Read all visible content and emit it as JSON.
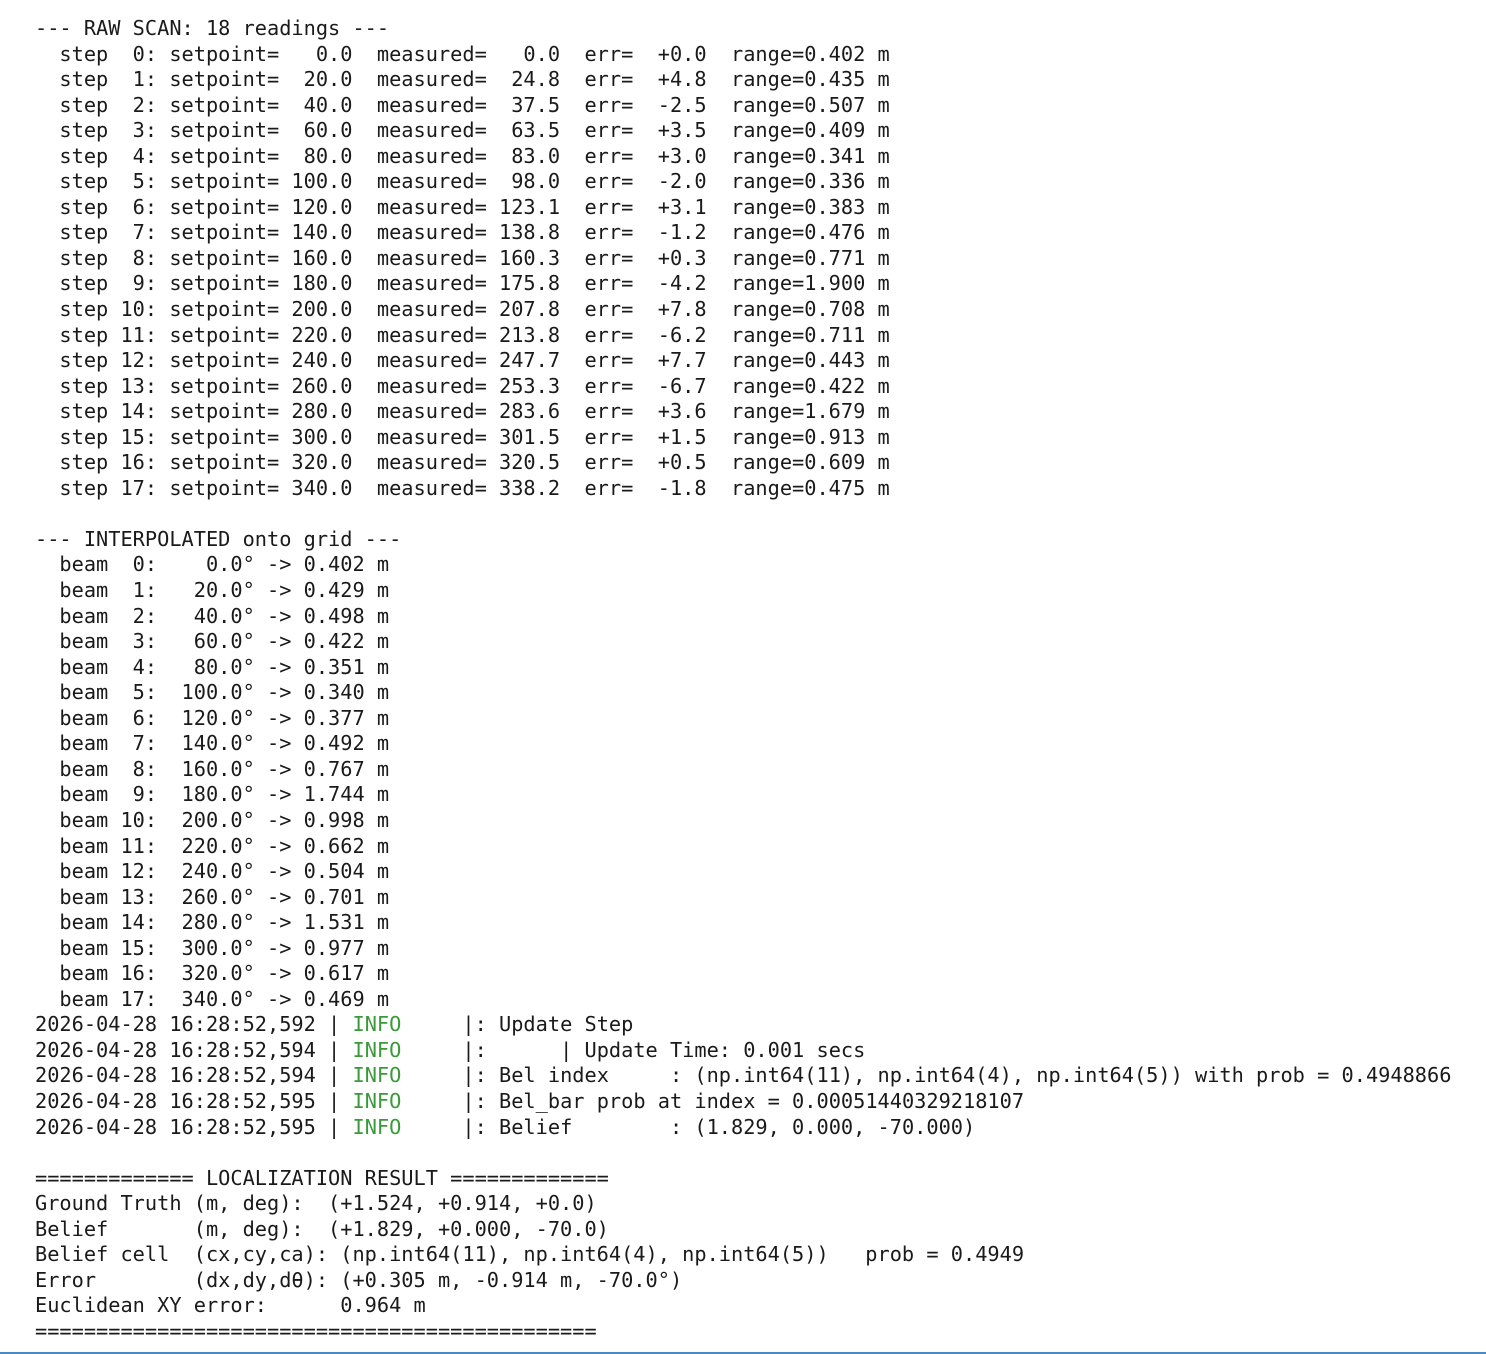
{
  "raw_scan": {
    "header": "--- RAW SCAN: 18 readings ---",
    "rows": [
      "  step  0: setpoint=   0.0  measured=   0.0  err=  +0.0  range=0.402 m",
      "  step  1: setpoint=  20.0  measured=  24.8  err=  +4.8  range=0.435 m",
      "  step  2: setpoint=  40.0  measured=  37.5  err=  -2.5  range=0.507 m",
      "  step  3: setpoint=  60.0  measured=  63.5  err=  +3.5  range=0.409 m",
      "  step  4: setpoint=  80.0  measured=  83.0  err=  +3.0  range=0.341 m",
      "  step  5: setpoint= 100.0  measured=  98.0  err=  -2.0  range=0.336 m",
      "  step  6: setpoint= 120.0  measured= 123.1  err=  +3.1  range=0.383 m",
      "  step  7: setpoint= 140.0  measured= 138.8  err=  -1.2  range=0.476 m",
      "  step  8: setpoint= 160.0  measured= 160.3  err=  +0.3  range=0.771 m",
      "  step  9: setpoint= 180.0  measured= 175.8  err=  -4.2  range=1.900 m",
      "  step 10: setpoint= 200.0  measured= 207.8  err=  +7.8  range=0.708 m",
      "  step 11: setpoint= 220.0  measured= 213.8  err=  -6.2  range=0.711 m",
      "  step 12: setpoint= 240.0  measured= 247.7  err=  +7.7  range=0.443 m",
      "  step 13: setpoint= 260.0  measured= 253.3  err=  -6.7  range=0.422 m",
      "  step 14: setpoint= 280.0  measured= 283.6  err=  +3.6  range=1.679 m",
      "  step 15: setpoint= 300.0  measured= 301.5  err=  +1.5  range=0.913 m",
      "  step 16: setpoint= 320.0  measured= 320.5  err=  +0.5  range=0.609 m",
      "  step 17: setpoint= 340.0  measured= 338.2  err=  -1.8  range=0.475 m"
    ]
  },
  "interpolated": {
    "header": "--- INTERPOLATED onto grid ---",
    "rows": [
      "  beam  0:    0.0° -> 0.402 m",
      "  beam  1:   20.0° -> 0.429 m",
      "  beam  2:   40.0° -> 0.498 m",
      "  beam  3:   60.0° -> 0.422 m",
      "  beam  4:   80.0° -> 0.351 m",
      "  beam  5:  100.0° -> 0.340 m",
      "  beam  6:  120.0° -> 0.377 m",
      "  beam  7:  140.0° -> 0.492 m",
      "  beam  8:  160.0° -> 0.767 m",
      "  beam  9:  180.0° -> 1.744 m",
      "  beam 10:  200.0° -> 0.998 m",
      "  beam 11:  220.0° -> 0.662 m",
      "  beam 12:  240.0° -> 0.504 m",
      "  beam 13:  260.0° -> 0.701 m",
      "  beam 14:  280.0° -> 1.531 m",
      "  beam 15:  300.0° -> 0.977 m",
      "  beam 16:  320.0° -> 0.617 m",
      "  beam 17:  340.0° -> 0.469 m"
    ]
  },
  "logs": [
    {
      "prefix": "2026-04-28 16:28:52,592 | ",
      "level": "INFO",
      "message": "     |: Update Step"
    },
    {
      "prefix": "2026-04-28 16:28:52,594 | ",
      "level": "INFO",
      "message": "     |:      | Update Time: 0.001 secs"
    },
    {
      "prefix": "2026-04-28 16:28:52,594 | ",
      "level": "INFO",
      "message": "     |: Bel index     : (np.int64(11), np.int64(4), np.int64(5)) with prob = 0.4948866"
    },
    {
      "prefix": "2026-04-28 16:28:52,595 | ",
      "level": "INFO",
      "message": "     |: Bel_bar prob at index = 0.00051440329218107"
    },
    {
      "prefix": "2026-04-28 16:28:52,595 | ",
      "level": "INFO",
      "message": "     |: Belief        : (1.829, 0.000, -70.000)"
    }
  ],
  "result": {
    "header": "============= LOCALIZATION RESULT =============",
    "rows": [
      "Ground Truth (m, deg):  (+1.524, +0.914, +0.0)",
      "Belief       (m, deg):  (+1.829, +0.000, -70.0)",
      "Belief cell  (cx,cy,ca): (np.int64(11), np.int64(4), np.int64(5))   prob = 0.4949",
      "Error        (dx,dy,dθ): (+0.305 m, -0.914 m, -70.0°)",
      "Euclidean XY error:      0.964 m"
    ],
    "footer": "=============================================="
  },
  "colors": {
    "text": "#1a1a1a",
    "info": "#3a9a3a",
    "bottom_border": "#4a8ac4"
  }
}
